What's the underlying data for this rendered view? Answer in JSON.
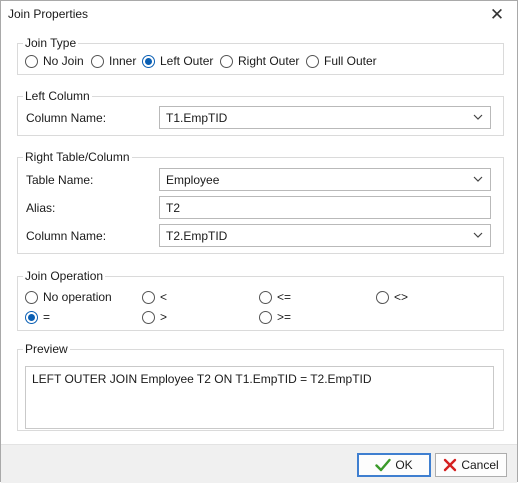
{
  "window": {
    "title": "Join Properties",
    "close_glyph": "✕"
  },
  "join_type": {
    "label": "Join Type",
    "options": [
      "No Join",
      "Inner",
      "Left Outer",
      "Right Outer",
      "Full Outer"
    ],
    "selected": "Left Outer"
  },
  "left_column": {
    "label": "Left Column",
    "column_name_label": "Column Name:",
    "column_name_value": "T1.EmpTID"
  },
  "right_table": {
    "label": "Right Table/Column",
    "table_name_label": "Table Name:",
    "table_name_value": "Employee",
    "alias_label": "Alias:",
    "alias_value": "T2",
    "column_name_label": "Column Name:",
    "column_name_value": "T2.EmpTID"
  },
  "join_operation": {
    "label": "Join Operation",
    "options": [
      "No operation",
      "<",
      "<=",
      "<>",
      "=",
      ">",
      ">="
    ],
    "selected": "="
  },
  "preview": {
    "label": "Preview",
    "text": "LEFT OUTER JOIN Employee T2 ON T1.EmpTID = T2.EmpTID"
  },
  "buttons": {
    "ok": "OK",
    "cancel": "Cancel"
  },
  "colors": {
    "radio_accent": "#0a5fb4",
    "ok_icon": "#3a9a2a",
    "cancel_icon": "#d42020",
    "ok_border": "#3f7fd0"
  },
  "icons": {
    "ok": "check-icon",
    "cancel": "x-icon",
    "dropdown": "chevron-down-icon",
    "close": "close-icon"
  }
}
